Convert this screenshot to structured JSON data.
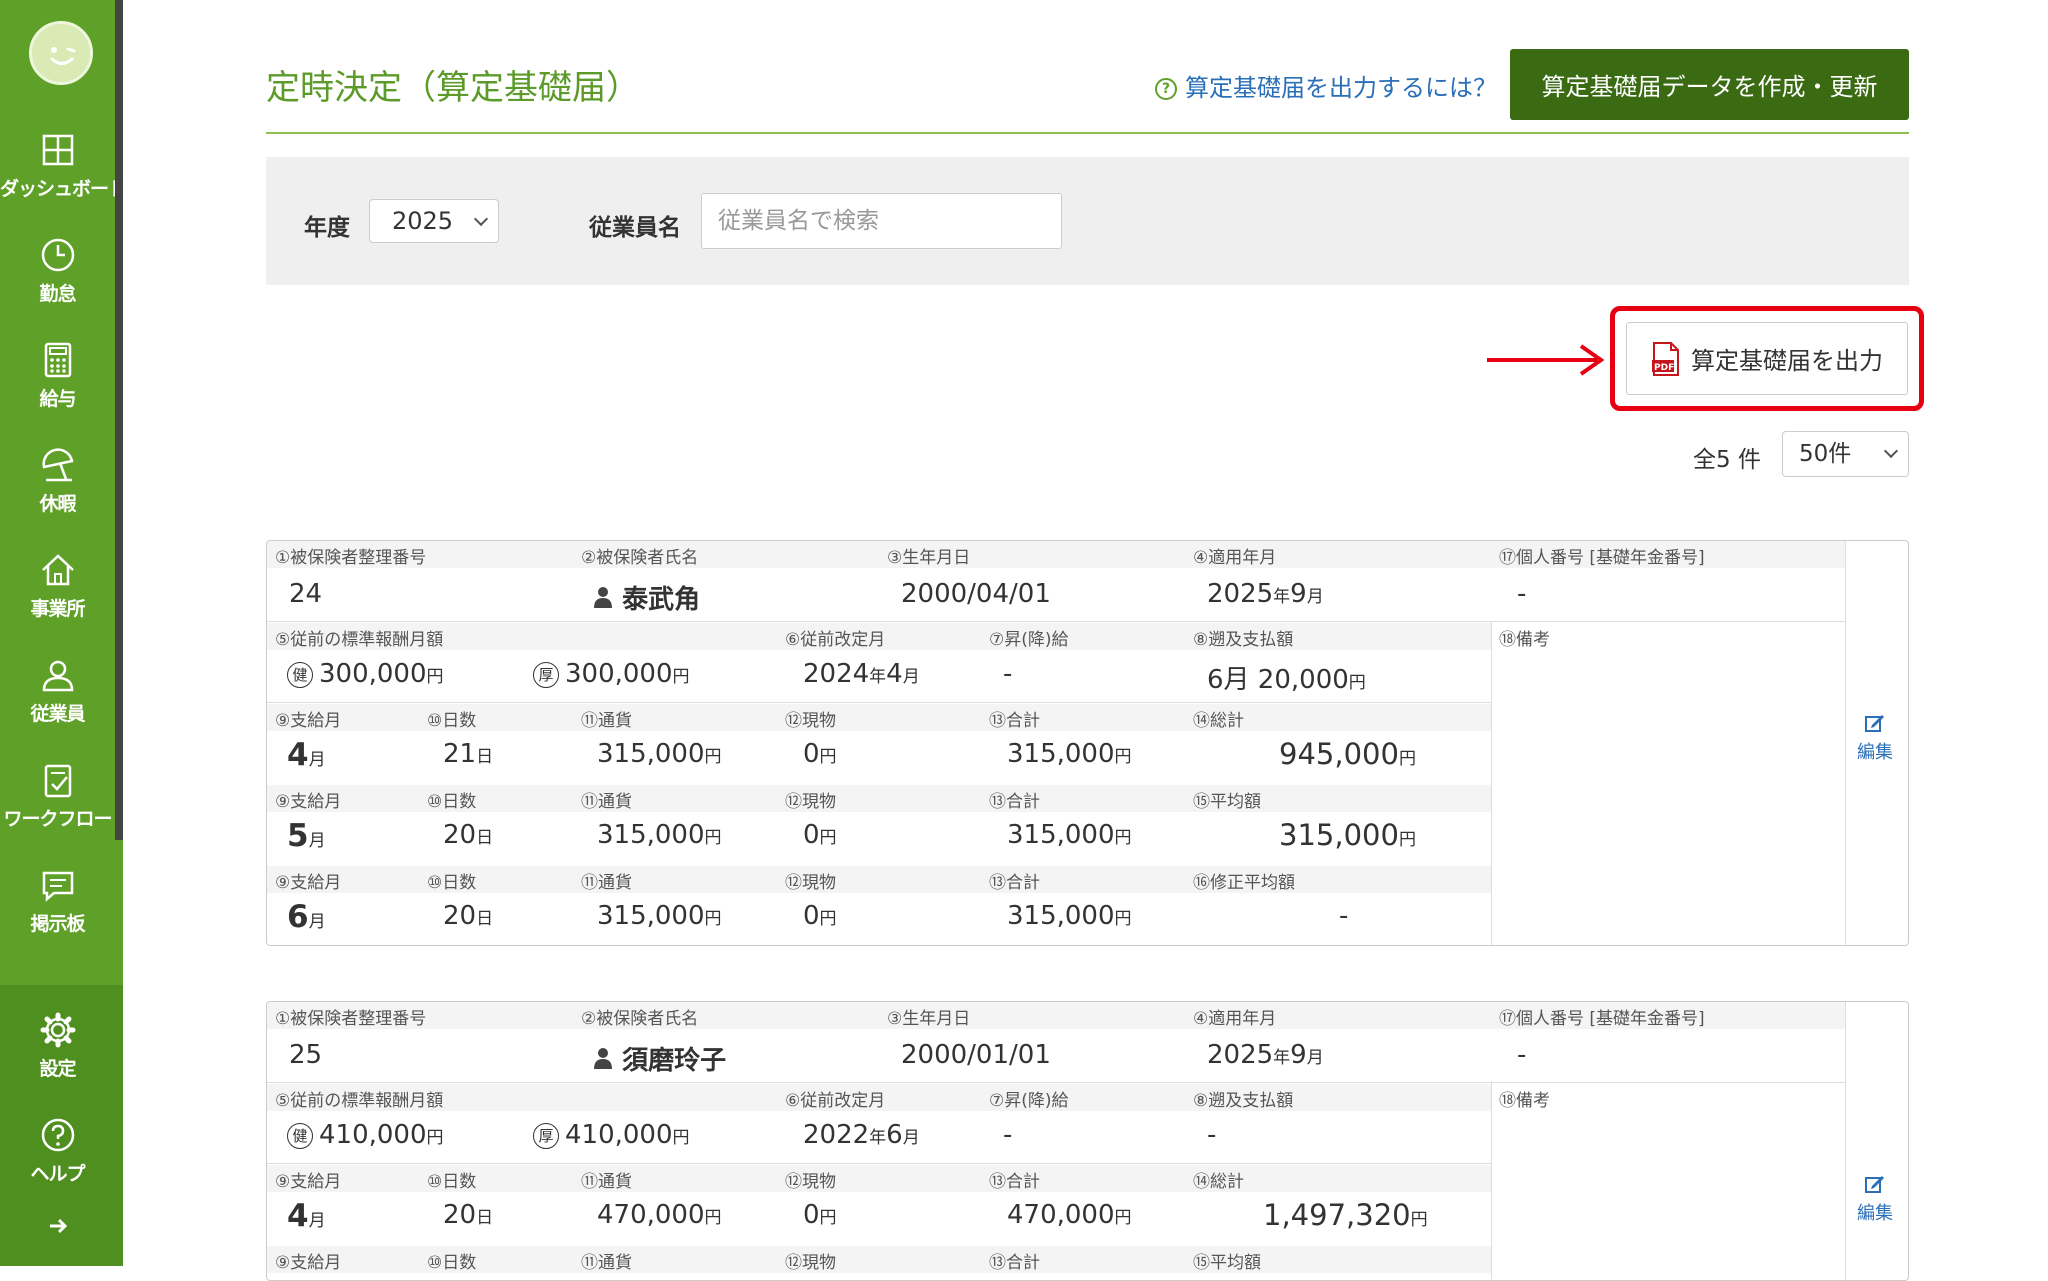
{
  "sidebar": {
    "items": [
      {
        "label": "ダッシュボード",
        "icon": "dashboard-icon"
      },
      {
        "label": "勤怠",
        "icon": "clock-icon"
      },
      {
        "label": "給与",
        "icon": "calculator-icon"
      },
      {
        "label": "休暇",
        "icon": "umbrella-icon"
      },
      {
        "label": "事業所",
        "icon": "home-icon"
      },
      {
        "label": "従業員",
        "icon": "person-icon"
      },
      {
        "label": "ワークフロー",
        "icon": "workflow-icon"
      },
      {
        "label": "掲示板",
        "icon": "chat-icon"
      },
      {
        "label": "設定",
        "icon": "gear-icon"
      },
      {
        "label": "ヘルプ",
        "icon": "help-icon"
      }
    ]
  },
  "header": {
    "title": "定時決定（算定基礎届）",
    "help_link": "算定基礎届を出力するには？",
    "help_icon_glyph": "?",
    "create_button": "算定基礎届データを作成・更新"
  },
  "filters": {
    "year_label": "年度",
    "year_value": "2025",
    "employee_label": "従業員名",
    "employee_placeholder": "従業員名で検索"
  },
  "output_button": "算定基礎届を出力",
  "pdf_icon_text": "PDF",
  "count_label": "全5 件",
  "per_page": "50件",
  "labels": {
    "l1": "①被保険者整理番号",
    "l2": "②被保険者氏名",
    "l3": "③生年月日",
    "l4": "④適用年月",
    "l17": "⑰個人番号 [基礎年金番号]",
    "l5": "⑤従前の標準報酬月額",
    "l6": "⑥従前改定月",
    "l7": "⑦昇(降)給",
    "l8": "⑧遡及支払額",
    "l18": "⑱備考",
    "l9": "⑨支給月",
    "l10": "⑩日数",
    "l11": "⑪通貨",
    "l12": "⑫現物",
    "l13": "⑬合計",
    "l14": "⑭総計",
    "l15": "⑮平均額",
    "l16": "⑯修正平均額",
    "health_badge": "健",
    "pension_badge": "厚",
    "edit": "編集",
    "yen": "円",
    "month": "月",
    "day": "日",
    "year": "年"
  },
  "records": [
    {
      "number": "24",
      "name": "泰武角",
      "birth": "2000/04/01",
      "apply_year": "2025",
      "apply_month": "9",
      "personal_number": "-",
      "prev_health": "300,000",
      "prev_pension": "300,000",
      "prev_rev_year": "2024",
      "prev_rev_month": "4",
      "raise": "-",
      "retro": "6月 20,000",
      "months": [
        {
          "month": "4",
          "days": "21",
          "cash": "315,000",
          "goods": "0",
          "total": "315,000"
        },
        {
          "month": "5",
          "days": "20",
          "cash": "315,000",
          "goods": "0",
          "total": "315,000"
        },
        {
          "month": "6",
          "days": "20",
          "cash": "315,000",
          "goods": "0",
          "total": "315,000"
        }
      ],
      "grand_total": "945,000",
      "average": "315,000",
      "adjusted_average": "-"
    },
    {
      "number": "25",
      "name": "須磨玲子",
      "birth": "2000/01/01",
      "apply_year": "2025",
      "apply_month": "9",
      "personal_number": "-",
      "prev_health": "410,000",
      "prev_pension": "410,000",
      "prev_rev_year": "2022",
      "prev_rev_month": "6",
      "raise": "-",
      "retro": "-",
      "months": [
        {
          "month": "4",
          "days": "20",
          "cash": "470,000",
          "goods": "0",
          "total": "470,000"
        }
      ],
      "grand_total": "1,497,320"
    }
  ],
  "colors": {
    "sidebar": "#5fa128",
    "title": "#5c9a2a",
    "create_button": "#3a6b12",
    "link": "#2a6fb8",
    "highlight": "#e60012"
  }
}
